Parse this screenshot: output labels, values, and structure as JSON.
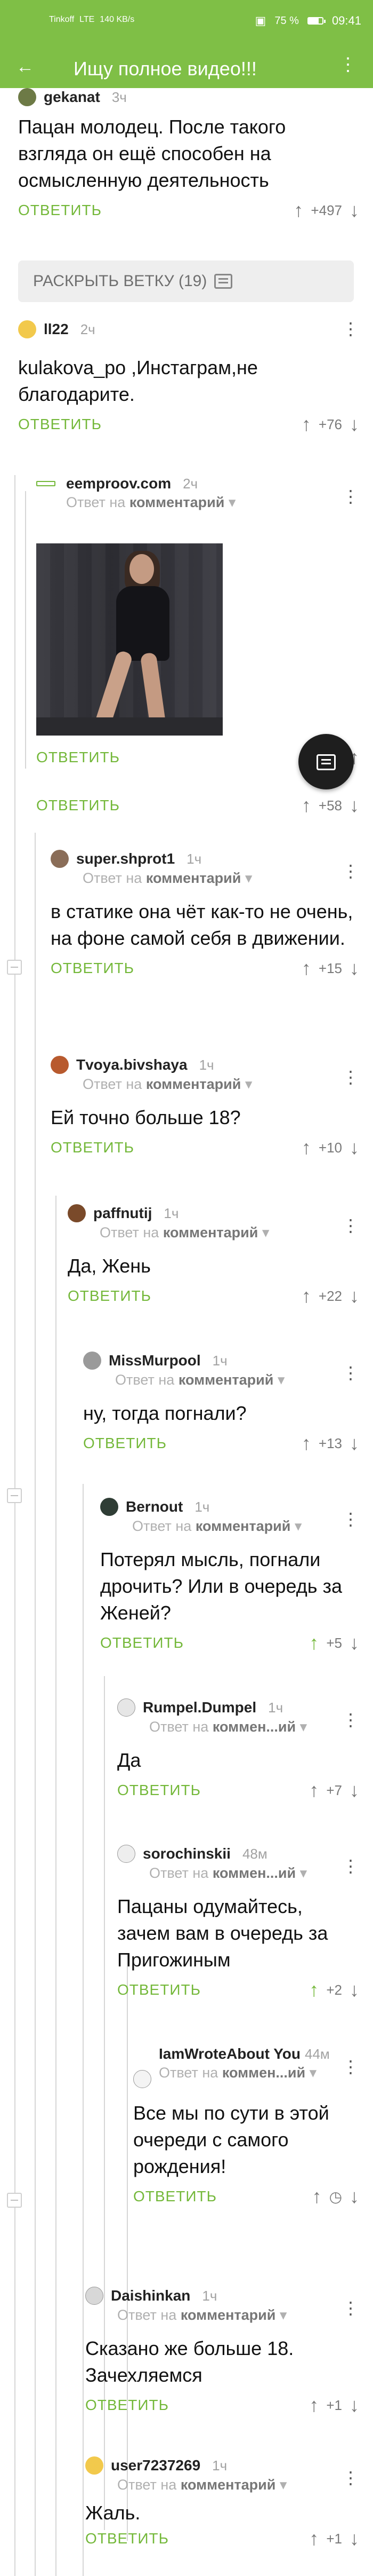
{
  "status_bar": {
    "carrier": "Tinkoff",
    "network": "LTE",
    "speed": "140 KB/s",
    "battery": "75 %",
    "battery_level": 0.75,
    "time": "09:41"
  },
  "app_bar": {
    "title": "Ищу полное видео!!!"
  },
  "expand_thread": {
    "label": "РАСКРЫТЬ ВЕТКУ (19)"
  },
  "labels": {
    "reply": "ОТВЕТИТЬ",
    "reply_prefix": "Ответ на",
    "reply_target": "комментарий",
    "reply_target_short": "коммен...ий"
  },
  "comments": [
    {
      "username": "gekanat",
      "time": "3ч",
      "text": "Пацан молодец. После такого взгляда он ещё способен на осмысленную деятельность",
      "score": "+497"
    },
    {
      "username": "ll22",
      "time": "2ч",
      "text": "kulakova_po ,Инстаграм,не благодарите.",
      "score": "+76"
    },
    {
      "username": "eemproov.com",
      "time": "2ч",
      "text": "",
      "score": ""
    },
    {
      "username": "",
      "time": "",
      "text": "",
      "score": "+58"
    },
    {
      "username": "super.shprot1",
      "time": "1ч",
      "text": "в статике она чёт как-то не очень, на фоне самой себя в движении.",
      "score": "+15"
    },
    {
      "username": "Tvoya.bivshaya",
      "time": "1ч",
      "text": "Ей точно больше 18?",
      "score": "+10"
    },
    {
      "username": "paffnutij",
      "time": "1ч",
      "text": "Да, Жень",
      "score": "+22"
    },
    {
      "username": "MissMurpool",
      "time": "1ч",
      "text": "ну, тогда погнали?",
      "score": "+13"
    },
    {
      "username": "Bernout",
      "time": "1ч",
      "text": "Потерял мысль, погнали дрочить? Или в очередь за Женей?",
      "score": "+5"
    },
    {
      "username": "Rumpel.Dumpel",
      "time": "1ч",
      "text": "Да",
      "score": "+7"
    },
    {
      "username": "sorochinskii",
      "time": "48м",
      "text": "Пацаны одумайтесь, зачем вам в очередь за Пригожиным",
      "score": "+2"
    },
    {
      "username": "IamWroteAbout You",
      "time": "44м",
      "text": "Все мы по сути в этой очереди с самого рождения!",
      "score": ""
    },
    {
      "username": "Daishinkan",
      "time": "1ч",
      "text": "Сказано же больше 18. Зачехляемся",
      "score": "+1"
    },
    {
      "username": "user7237269",
      "time": "1ч",
      "text": "Жаль.",
      "score": "+1"
    }
  ]
}
